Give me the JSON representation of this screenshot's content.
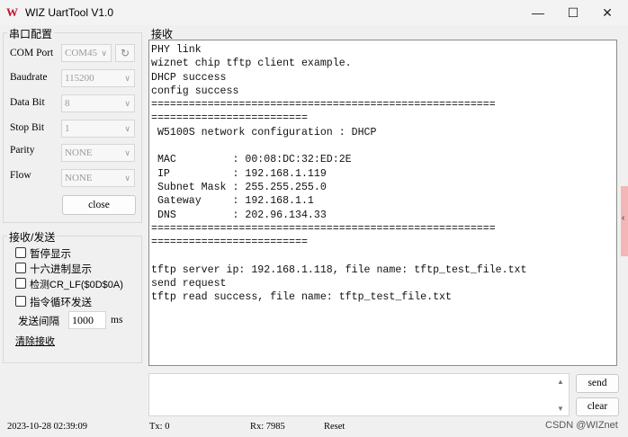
{
  "window": {
    "title": "WIZ UartTool V1.0",
    "icon": "wiznet-w-icon",
    "minimize": "—",
    "maximize": "☐",
    "close": "✕"
  },
  "serial_config": {
    "title": "串口配置",
    "com_port": {
      "label": "COM Port",
      "value": "COM45"
    },
    "baudrate": {
      "label": "Baudrate",
      "value": "115200"
    },
    "data_bit": {
      "label": "Data Bit",
      "value": "8"
    },
    "stop_bit": {
      "label": "Stop Bit",
      "value": "1"
    },
    "parity": {
      "label": "Parity",
      "value": "NONE"
    },
    "flow": {
      "label": "Flow",
      "value": "NONE"
    },
    "close_button": "close",
    "refresh_icon": "refresh-icon"
  },
  "send_recv": {
    "title": "接收/发送",
    "pause_display": "暂停显示",
    "hex_display": "十六进制显示",
    "detect_crlf": "检测CR_LF($0D$0A)",
    "loop_send": "指令循环发送",
    "interval_label": "发送间隔",
    "interval_value": "1000",
    "interval_unit": "ms",
    "clear_recv": "清除接收"
  },
  "receive": {
    "title": "接收",
    "lines": [
      "PHY link",
      "wiznet chip tftp client example.",
      "DHCP success",
      "config success",
      "=======================================================",
      "=========================",
      " W5100S network configuration : DHCP",
      "",
      " MAC         : 00:08:DC:32:ED:2E",
      " IP          : 192.168.1.119",
      " Subnet Mask : 255.255.255.0",
      " Gateway     : 192.168.1.1",
      " DNS         : 202.96.134.33",
      "=======================================================",
      "=========================",
      "",
      "tftp server ip: 192.168.1.118, file name: tftp_test_file.txt",
      "send request",
      "tftp read success, file name: tftp_test_file.txt"
    ]
  },
  "send_area": {
    "value": "",
    "send_button": "send",
    "clear_button": "clear"
  },
  "statusbar": {
    "datetime": "2023-10-28 02:39:09",
    "tx": "Tx: 0",
    "rx": "Rx: 7985",
    "reset": "Reset",
    "watermark": "CSDN @WIZnet"
  },
  "side_tab": {
    "glyph": "‹"
  }
}
